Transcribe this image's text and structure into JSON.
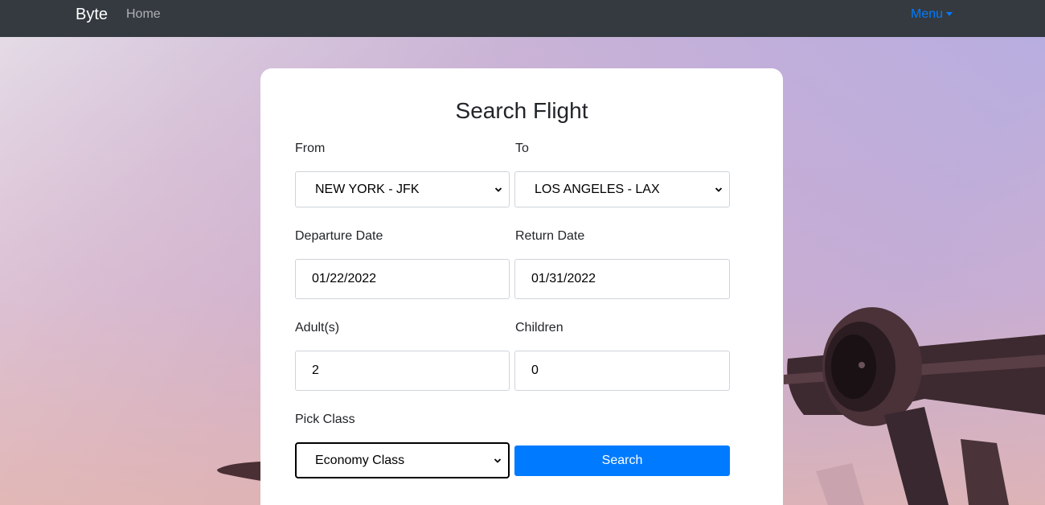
{
  "navbar": {
    "brand": "Byte",
    "home_label": "Home",
    "menu_label": "Menu"
  },
  "form": {
    "title": "Search Flight",
    "from": {
      "label": "From",
      "value": "NEW YORK - JFK"
    },
    "to": {
      "label": "To",
      "value": "LOS ANGELES - LAX"
    },
    "departure_date": {
      "label": "Departure Date",
      "value": "01/22/2022"
    },
    "return_date": {
      "label": "Return Date",
      "value": "01/31/2022"
    },
    "adults": {
      "label": "Adult(s)",
      "value": "2"
    },
    "children": {
      "label": "Children",
      "value": "0"
    },
    "class": {
      "label": "Pick Class",
      "value": "Economy Class"
    },
    "search_label": "Search"
  },
  "colors": {
    "navbar_bg": "#343a40",
    "accent": "#007bff",
    "card_bg": "#ffffff"
  },
  "icons": {
    "select_arrow": "chevron-down-icon",
    "menu_caret": "caret-down-icon"
  }
}
